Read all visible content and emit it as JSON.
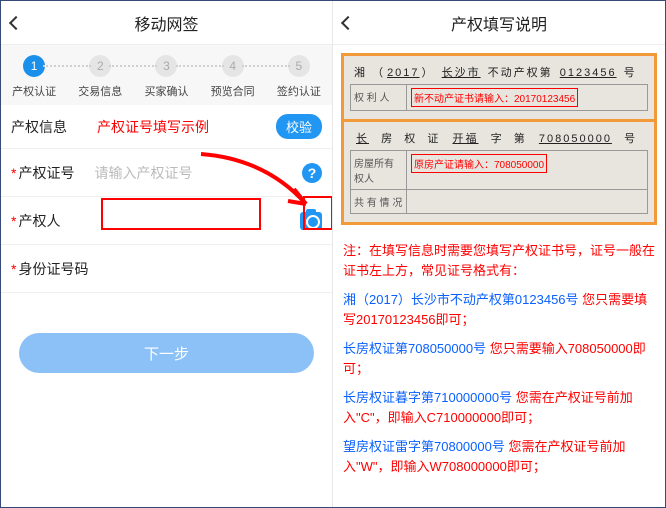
{
  "left": {
    "nav_title": "移动网签",
    "steps": [
      {
        "label": "产权认证"
      },
      {
        "label": "交易信息"
      },
      {
        "label": "买家确认"
      },
      {
        "label": "预览合同"
      },
      {
        "label": "签约认证"
      }
    ],
    "section_title": "产权信息",
    "section_hint": "产权证号填写示例",
    "verify_btn": "校验",
    "field1_label": "产权证号",
    "field1_placeholder": "请输入产权证号",
    "field2_label": "产权人",
    "field3_label": "身份证号码",
    "next_btn": "下一步"
  },
  "right": {
    "nav_title": "产权填写说明",
    "cert1_heading_parts": [
      "湘",
      "（",
      "2017",
      "）",
      "长沙市",
      "不动产权第",
      "0123456",
      "号"
    ],
    "cert1_row1_l": "权 利 人",
    "cert1_row1_r_pre": "新不动产证书请输入：",
    "cert1_row1_r_val": "20170123456",
    "cert2_heading_parts": [
      "长",
      "房",
      "权",
      "证",
      "开福",
      "字",
      "第",
      "708050000",
      "号"
    ],
    "cert2_row1_l": "房屋所有权人",
    "cert2_row1_r_pre": "原房产证请输入：",
    "cert2_row1_r_val": "708050000",
    "cert2_row2_l": "共 有 情 况",
    "instr_lead": "注：在填写信息时需要您填写产权证书号，证号一般在证书左上方，常见证号格式有：",
    "instr_items": [
      {
        "blue": "湘（2017）长沙市不动产权第0123456号",
        "rest": " 您只需要填写20170123456即可；"
      },
      {
        "blue": "长房权证第708050000号",
        "rest": " 您只需要输入708050000即可；"
      },
      {
        "blue": "长房权证暮字第710000000号",
        "rest": " 您需在产权证号前加入\"C\"，即输入C710000000即可；"
      },
      {
        "blue": "望房权证雷字第70800000号",
        "rest": " 您需在产权证号前加入\"W\"，即输入W708000000即可；"
      }
    ]
  }
}
